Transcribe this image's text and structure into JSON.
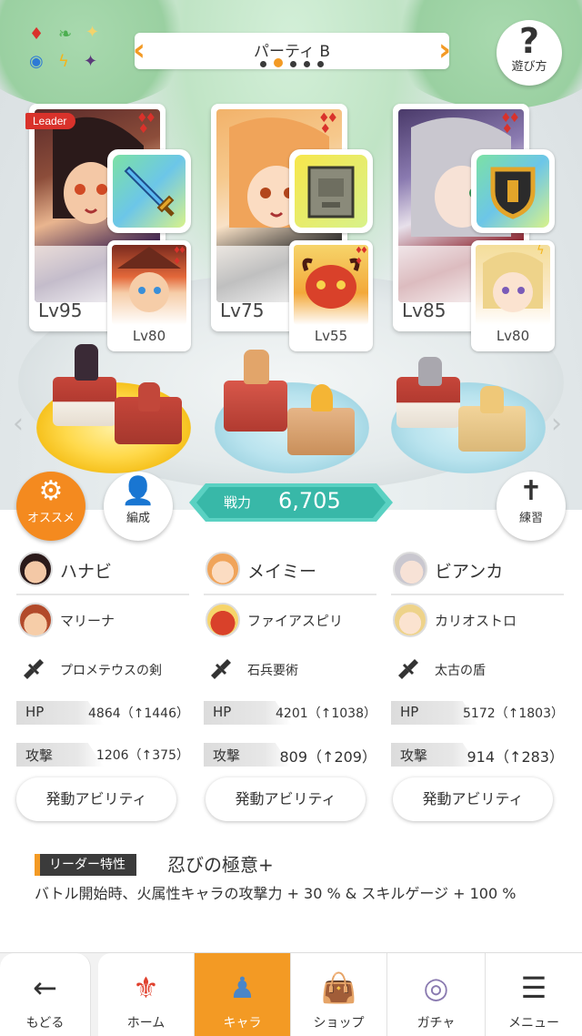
{
  "header": {
    "party_title": "パーティ B",
    "prev_icon": "chevron-left-icon",
    "next_icon": "chevron-right-icon",
    "page_dots": 5,
    "active_dot": 2,
    "help_label": "遊び方",
    "help_glyph": "?"
  },
  "attribute_icons": [
    "fire-diamond",
    "wind-leaf",
    "light-star",
    "water-circle",
    "thunder-bolt",
    "dark-star"
  ],
  "cards": [
    {
      "leader_tag": "Leader",
      "level": "Lv95",
      "sub_level": "Lv80"
    },
    {
      "leader_tag": "",
      "level": "Lv75",
      "sub_level": "Lv55"
    },
    {
      "leader_tag": "",
      "level": "Lv85",
      "sub_level": "Lv80"
    }
  ],
  "buttons": {
    "recommend_label": "オススメ",
    "formation_label": "編成",
    "training_label": "練習"
  },
  "power": {
    "label": "戦力",
    "value": "6,705"
  },
  "columns": [
    {
      "name": "ハナビ",
      "sub_name": "マリーナ",
      "equipment": "プロメテウスの剣",
      "hp_label": "HP",
      "hp_value": "4864（↑1446）",
      "atk_label": "攻撃",
      "atk_value": "1206（↑375）",
      "ability_label": "発動アビリティ"
    },
    {
      "name": "メイミー",
      "sub_name": "ファイアスピリ",
      "equipment": "石兵要術",
      "hp_label": "HP",
      "hp_value": "4201（↑1038）",
      "atk_label": "攻撃",
      "atk_value": "809（↑209）",
      "ability_label": "発動アビリティ"
    },
    {
      "name": "ビアンカ",
      "sub_name": "カリオストロ",
      "equipment": "太古の盾",
      "hp_label": "HP",
      "hp_value": "5172（↑1803）",
      "atk_label": "攻撃",
      "atk_value": "914（↑283）",
      "ability_label": "発動アビリティ"
    }
  ],
  "leader_trait": {
    "label": "リーダー特性",
    "name": "忍びの極意+",
    "description": "バトル開始時、火属性キャラの攻撃力 + 30 % & スキルゲージ + 100 %"
  },
  "nav": {
    "back": "もどる",
    "home": "ホーム",
    "chara": "キャラ",
    "shop": "ショップ",
    "gacha": "ガチャ",
    "menu": "メニュー"
  },
  "colors": {
    "accent": "#f39a24",
    "power_teal": "#38b8a8",
    "fire_red": "#d9322b"
  }
}
